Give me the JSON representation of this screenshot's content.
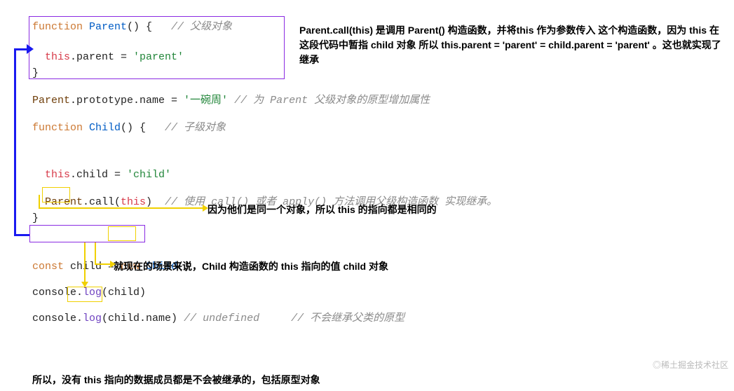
{
  "code": {
    "l1_kw": "function",
    "l1_name": " Parent",
    "l1_rest": "() {   ",
    "l1_com": "// 父级对象",
    "l2_this": "  this",
    "l2_mid": ".parent = ",
    "l2_str": "'parent'",
    "l3": "}",
    "l4_a": "Parent",
    "l4_b": ".prototype.name = ",
    "l4_str": "'一碗周'",
    "l4_com": " // 为 Parent 父级对象的原型增加属性",
    "l5_kw": "function",
    "l5_name": " Child",
    "l5_rest": "() {   ",
    "l5_com": "// 子级对象",
    "l6_this": "  this",
    "l6_mid": ".child = ",
    "l6_str": "'child'",
    "l7_a": "  Parent",
    "l7_b": ".call(",
    "l7_this": "this",
    "l7_c": ")  ",
    "l7_com": "// 使用 call() 或者 apply() 方法调用父级构造函数 实现继承。",
    "l8": "}",
    "l9_kw": "const",
    "l9_a": " child = ",
    "l9_new": "new",
    "l9_cls": " Child",
    "l9_b": "()",
    "l10_a": "console.",
    "l10_b": "log",
    "l10_c": "(child)",
    "l11_a": "console.",
    "l11_b": "log",
    "l11_c": "(child.name) ",
    "l11_com1": "// undefined",
    "l11_com2": "     // 不会继承父类的原型"
  },
  "notes": {
    "n1": "Parent.call(this) 是调用 Parent() 构造函数，并将this 作为参数传入 这个构造函数，因为 this 在这段代码中暂指 child 对象 所以 this.parent = 'parent' = child.parent = 'parent' 。这也就实现了继承",
    "n2": "因为他们是同一个对象，所以 this 的指向都是相同的",
    "n3": "就现在的场景来说，Child 构造函数的 this 指向的值 child 对象",
    "n4": "所以，没有 this 指向的数据成员都是不会被继承的，包括原型对象"
  },
  "watermark": "稀土掘金技术社区"
}
